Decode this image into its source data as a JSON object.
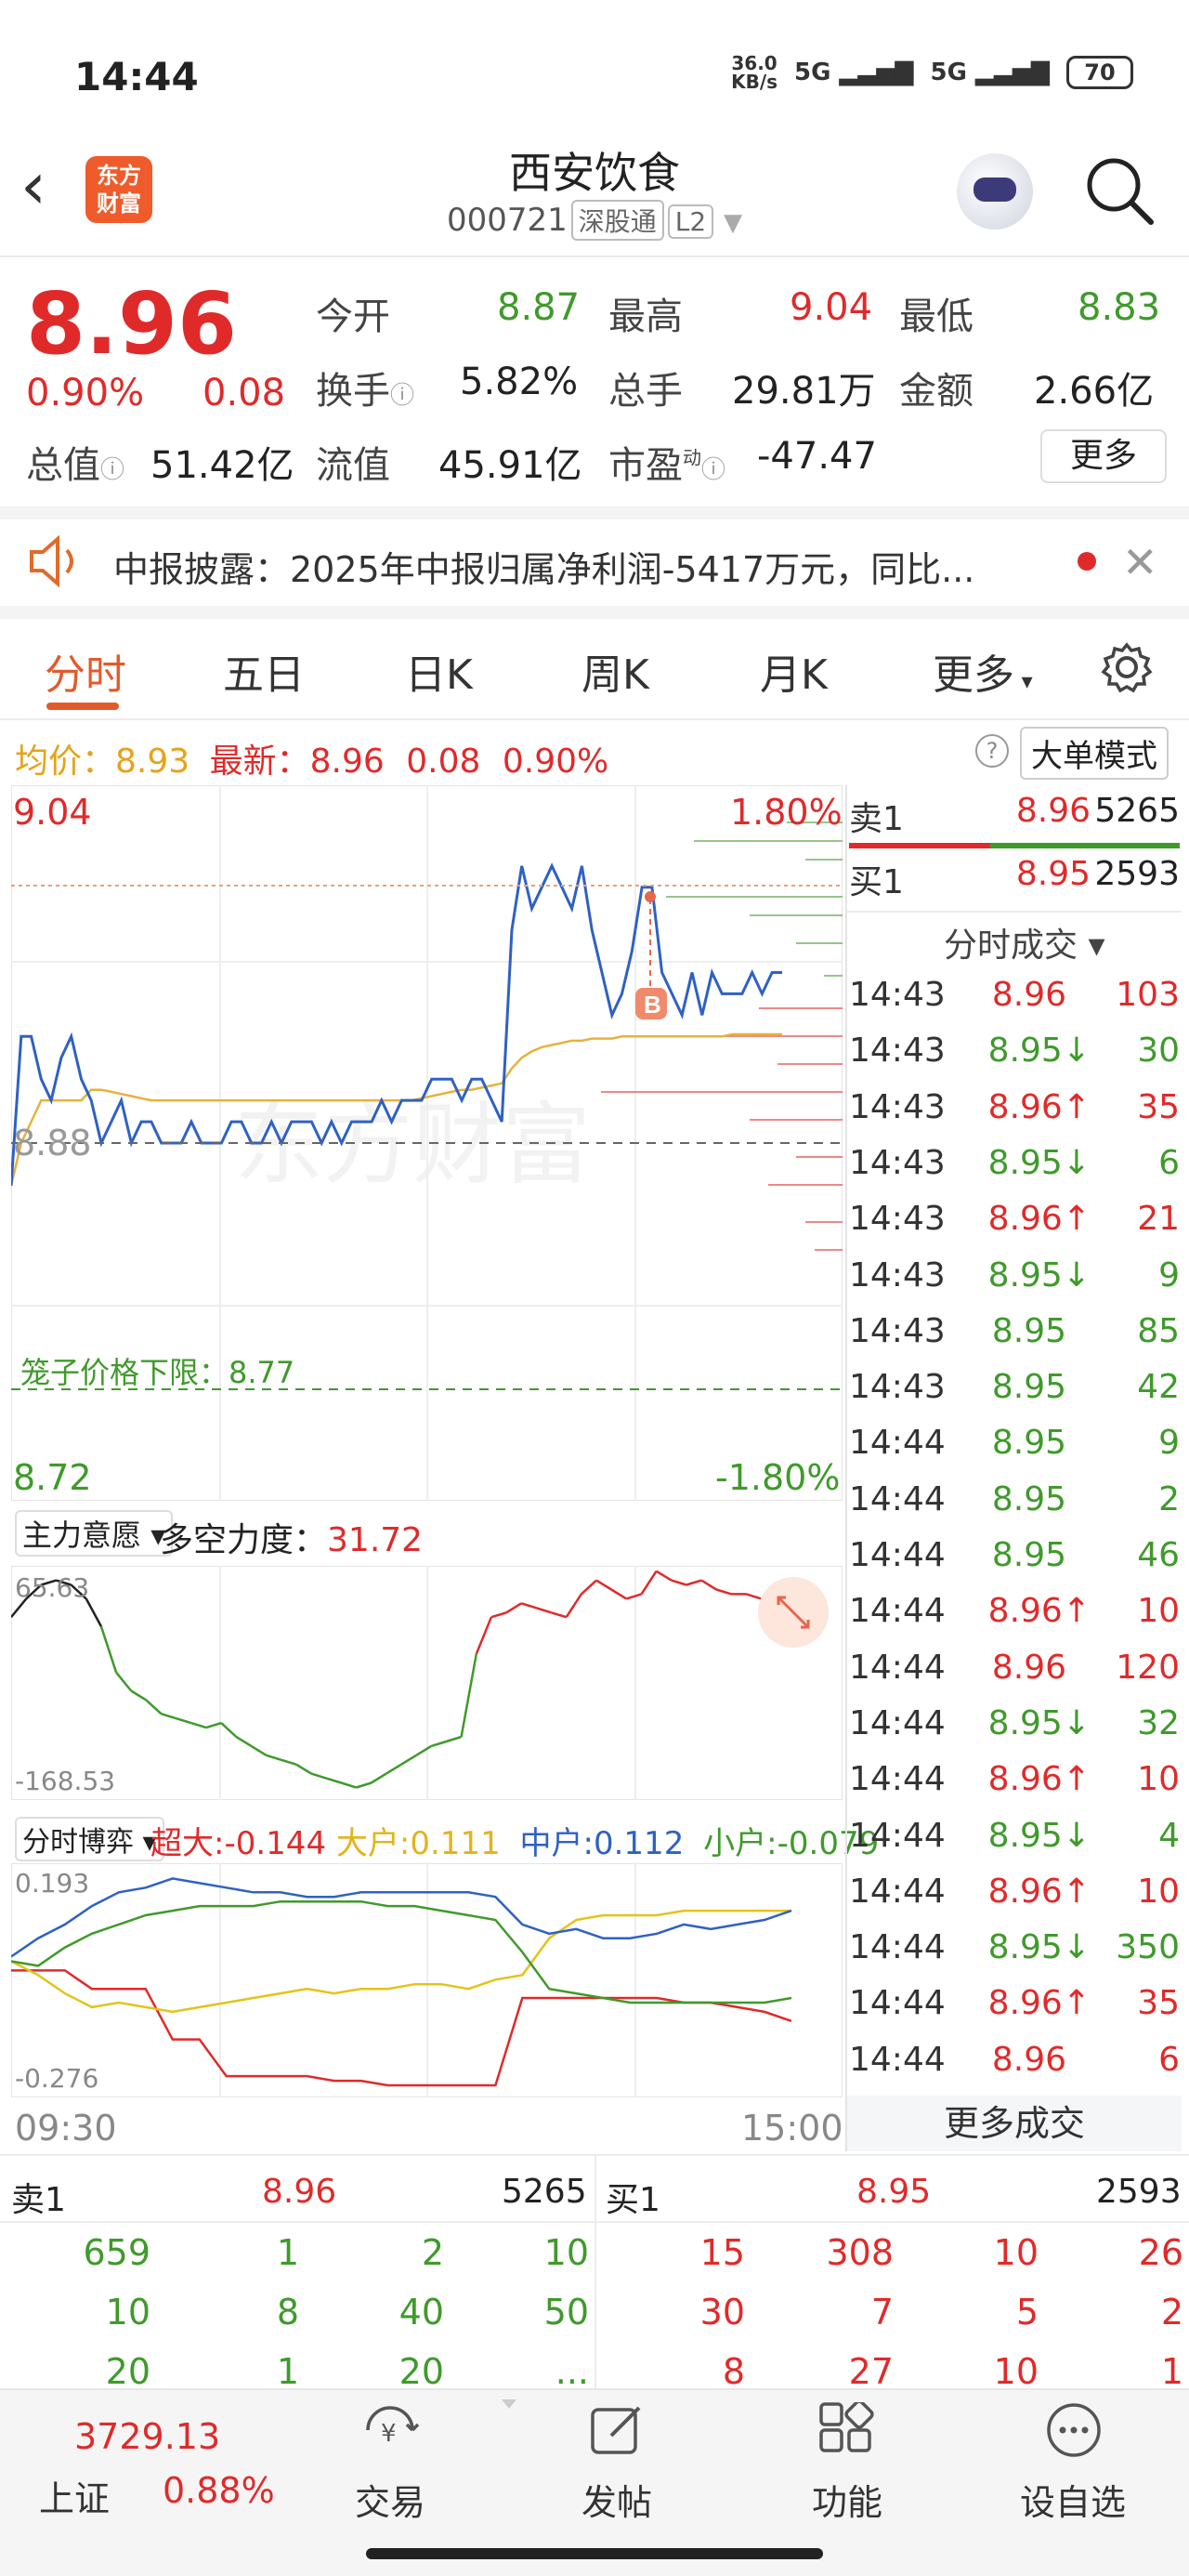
{
  "status_bar": {
    "time": "14:44",
    "net_speed_top": "36.0",
    "net_speed_bottom": "KB/s",
    "net1": "5G",
    "net2": "5G",
    "battery": "70"
  },
  "header": {
    "logo_line1": "东方",
    "logo_line2": "财富",
    "title": "西安饮食",
    "code": "000721",
    "tag1": "深股通",
    "tag2": "L2"
  },
  "quote": {
    "price": "8.96",
    "change_pct": "0.90%",
    "change": "0.08",
    "open_label": "今开",
    "open": "8.87",
    "high_label": "最高",
    "high": "9.04",
    "low_label": "最低",
    "low": "8.83",
    "turnover_label": "换手",
    "turnover": "5.82%",
    "volume_label": "总手",
    "volume": "29.81万",
    "amount_label": "金额",
    "amount": "2.66亿",
    "mktcap_label": "总值",
    "mktcap": "51.42亿",
    "float_label": "流值",
    "float": "45.91亿",
    "pe_label": "市盈",
    "pe_sup": "动",
    "pe": "-47.47",
    "more": "更多"
  },
  "notice": {
    "text": "中报披露：2025年中报归属净利润-5417万元，同比..."
  },
  "tabs": [
    "分时",
    "五日",
    "日K",
    "周K",
    "月K",
    "更多"
  ],
  "chart_header": {
    "avg_label": "均价：",
    "avg": "8.93",
    "latest_label": "最新：",
    "latest": "8.96",
    "chg": "0.08",
    "pct": "0.90%",
    "big_order": "大单模式"
  },
  "chart_data": [
    {
      "type": "line",
      "title": "",
      "price_top": "9.04",
      "price_mid": "8.88",
      "price_bottom": "8.72",
      "pct_top": "1.80%",
      "pct_bottom": "-1.80%",
      "cage_label": "笼子价格下限：",
      "cage_value": "8.77",
      "ylim": [
        8.72,
        9.04
      ],
      "x_start": "09:30",
      "x_end": "15:00",
      "series": [
        {
          "name": "价格",
          "values": [
            8.86,
            8.93,
            8.93,
            8.91,
            8.9,
            8.92,
            8.93,
            8.91,
            8.9,
            8.88,
            8.89,
            8.9,
            8.88,
            8.89,
            8.89,
            8.88,
            8.88,
            8.88,
            8.89,
            8.88,
            8.88,
            8.88,
            8.89,
            8.89,
            8.88,
            8.88,
            8.89,
            8.88,
            8.89,
            8.89,
            8.89,
            8.88,
            8.89,
            8.88,
            8.89,
            8.89,
            8.89,
            8.9,
            8.89,
            8.9,
            8.9,
            8.9,
            8.91,
            8.91,
            8.91,
            8.9,
            8.91,
            8.91,
            8.9,
            8.89,
            8.98,
            9.01,
            8.99,
            9.0,
            9.01,
            9.0,
            8.99,
            9.01,
            8.98,
            8.96,
            8.94,
            8.95,
            8.97,
            9.0,
            9.0,
            8.96,
            8.95,
            8.94,
            8.96,
            8.94,
            8.96,
            8.95,
            8.95,
            8.95,
            8.96,
            8.95,
            8.96,
            8.96
          ]
        },
        {
          "name": "均价",
          "values": [
            8.86,
            8.88,
            8.89,
            8.9,
            8.9,
            8.9,
            8.9,
            8.9,
            8.905,
            8.905,
            8.904,
            8.903,
            8.902,
            8.901,
            8.9,
            8.9,
            8.9,
            8.9,
            8.9,
            8.9,
            8.9,
            8.9,
            8.9,
            8.9,
            8.9,
            8.9,
            8.9,
            8.9,
            8.9,
            8.9,
            8.9,
            8.9,
            8.9,
            8.9,
            8.9,
            8.9,
            8.9,
            8.9,
            8.9,
            8.9,
            8.9,
            8.901,
            8.902,
            8.903,
            8.904,
            8.905,
            8.905,
            8.906,
            8.907,
            8.908,
            8.915,
            8.92,
            8.923,
            8.925,
            8.926,
            8.927,
            8.928,
            8.928,
            8.929,
            8.929,
            8.929,
            8.93,
            8.93,
            8.93,
            8.93,
            8.93,
            8.93,
            8.93,
            8.93,
            8.93,
            8.93,
            8.93,
            8.931,
            8.931,
            8.931,
            8.931,
            8.931,
            8.931
          ]
        }
      ]
    },
    {
      "type": "line",
      "title": "",
      "selector": "主力意愿",
      "metric_label": "多空力度：",
      "metric_value": "31.72",
      "ymax_label": "65.63",
      "ymin_label": "-168.53",
      "ylim": [
        -168.53,
        65.63
      ],
      "series": [
        {
          "name": "主力意愿",
          "values": [
            20,
            40,
            55,
            60,
            55,
            40,
            10,
            -40,
            -60,
            -70,
            -85,
            -90,
            -95,
            -100,
            -95,
            -110,
            -120,
            -130,
            -135,
            -140,
            -150,
            -155,
            -160,
            -165,
            -160,
            -150,
            -140,
            -130,
            -120,
            -115,
            -110,
            -20,
            20,
            25,
            35,
            30,
            25,
            20,
            45,
            60,
            50,
            40,
            45,
            70,
            60,
            55,
            60,
            50,
            45,
            45,
            40,
            30,
            25
          ]
        }
      ]
    },
    {
      "type": "line",
      "title": "",
      "selector": "分时博弈",
      "ymax_label": "0.193",
      "ymin_label": "-0.276",
      "ylim": [
        -0.276,
        0.193
      ],
      "series": [
        {
          "name": "超大",
          "label": "超大:",
          "value": "-0.144",
          "values": [
            -0.02,
            -0.02,
            -0.02,
            -0.06,
            -0.06,
            -0.06,
            -0.17,
            -0.17,
            -0.25,
            -0.25,
            -0.25,
            -0.25,
            -0.26,
            -0.26,
            -0.27,
            -0.27,
            -0.27,
            -0.27,
            -0.27,
            -0.08,
            -0.08,
            -0.08,
            -0.08,
            -0.08,
            -0.08,
            -0.09,
            -0.09,
            -0.1,
            -0.11,
            -0.13
          ]
        },
        {
          "name": "大户",
          "label": "大户:",
          "value": "0.111",
          "values": [
            0.0,
            -0.03,
            -0.07,
            -0.1,
            -0.09,
            -0.1,
            -0.11,
            -0.1,
            -0.09,
            -0.08,
            -0.07,
            -0.06,
            -0.07,
            -0.06,
            -0.06,
            -0.05,
            -0.05,
            -0.06,
            -0.04,
            -0.03,
            0.05,
            0.09,
            0.1,
            0.1,
            0.1,
            0.11,
            0.11,
            0.11,
            0.11,
            0.11
          ]
        },
        {
          "name": "中户",
          "label": "中户:",
          "value": "0.112",
          "values": [
            0.01,
            0.05,
            0.08,
            0.12,
            0.15,
            0.16,
            0.18,
            0.17,
            0.16,
            0.15,
            0.15,
            0.14,
            0.14,
            0.15,
            0.15,
            0.15,
            0.15,
            0.15,
            0.14,
            0.08,
            0.06,
            0.07,
            0.05,
            0.05,
            0.06,
            0.08,
            0.07,
            0.08,
            0.09,
            0.11
          ]
        },
        {
          "name": "小户",
          "label": "小户:",
          "value": "-0.079",
          "values": [
            0.0,
            -0.01,
            0.03,
            0.06,
            0.08,
            0.1,
            0.11,
            0.12,
            0.12,
            0.12,
            0.13,
            0.13,
            0.13,
            0.13,
            0.12,
            0.12,
            0.11,
            0.1,
            0.09,
            0.02,
            -0.06,
            -0.07,
            -0.08,
            -0.09,
            -0.09,
            -0.09,
            -0.09,
            -0.09,
            -0.09,
            -0.08
          ]
        }
      ]
    }
  ],
  "trades": {
    "sell1_label": "卖1",
    "sell1_price": "8.96",
    "sell1_vol": "5265",
    "buy1_label": "买1",
    "buy1_price": "8.95",
    "buy1_vol": "2593",
    "section_label": "分时成交",
    "rows": [
      {
        "t": "14:43",
        "p": "8.96",
        "d": "",
        "v": "103",
        "c": "red"
      },
      {
        "t": "14:43",
        "p": "8.95",
        "d": "↓",
        "v": "30",
        "c": "green"
      },
      {
        "t": "14:43",
        "p": "8.96",
        "d": "↑",
        "v": "35",
        "c": "red"
      },
      {
        "t": "14:43",
        "p": "8.95",
        "d": "↓",
        "v": "6",
        "c": "green"
      },
      {
        "t": "14:43",
        "p": "8.96",
        "d": "↑",
        "v": "21",
        "c": "red"
      },
      {
        "t": "14:43",
        "p": "8.95",
        "d": "↓",
        "v": "9",
        "c": "green"
      },
      {
        "t": "14:43",
        "p": "8.95",
        "d": "",
        "v": "85",
        "c": "green"
      },
      {
        "t": "14:43",
        "p": "8.95",
        "d": "",
        "v": "42",
        "c": "green"
      },
      {
        "t": "14:44",
        "p": "8.95",
        "d": "",
        "v": "9",
        "c": "green"
      },
      {
        "t": "14:44",
        "p": "8.95",
        "d": "",
        "v": "2",
        "c": "green"
      },
      {
        "t": "14:44",
        "p": "8.95",
        "d": "",
        "v": "46",
        "c": "green"
      },
      {
        "t": "14:44",
        "p": "8.96",
        "d": "↑",
        "v": "10",
        "c": "red"
      },
      {
        "t": "14:44",
        "p": "8.96",
        "d": "",
        "v": "120",
        "c": "red"
      },
      {
        "t": "14:44",
        "p": "8.95",
        "d": "↓",
        "v": "32",
        "c": "green"
      },
      {
        "t": "14:44",
        "p": "8.96",
        "d": "↑",
        "v": "10",
        "c": "red"
      },
      {
        "t": "14:44",
        "p": "8.95",
        "d": "↓",
        "v": "4",
        "c": "green"
      },
      {
        "t": "14:44",
        "p": "8.96",
        "d": "↑",
        "v": "10",
        "c": "red"
      },
      {
        "t": "14:44",
        "p": "8.95",
        "d": "↓",
        "v": "350",
        "c": "green"
      },
      {
        "t": "14:44",
        "p": "8.96",
        "d": "↑",
        "v": "35",
        "c": "red"
      },
      {
        "t": "14:44",
        "p": "8.96",
        "d": "",
        "v": "6",
        "c": "red"
      }
    ],
    "more": "更多成交"
  },
  "orderbook": {
    "sell_label": "卖1",
    "sell_price": "8.96",
    "sell_vol": "5265",
    "buy_label": "买1",
    "buy_price": "8.95",
    "buy_vol": "2593",
    "sell_rows": [
      [
        "659",
        "1",
        "2",
        "10"
      ],
      [
        "10",
        "8",
        "40",
        "50"
      ],
      [
        "20",
        "1",
        "20",
        "..."
      ]
    ],
    "buy_rows": [
      [
        "15",
        "308",
        "10",
        "26"
      ],
      [
        "30",
        "7",
        "5",
        "2"
      ],
      [
        "8",
        "27",
        "10",
        "1"
      ]
    ]
  },
  "index": {
    "value": "3729.13",
    "name": "上证",
    "pct": "0.88%"
  },
  "bottom_nav": [
    "交易",
    "发帖",
    "功能",
    "设自选"
  ],
  "colors": {
    "red": "#e02a2a",
    "green": "#3f9a2b",
    "price_line": "#2f61c4",
    "avg_line": "#e6b23a",
    "accent": "#e35a2a"
  }
}
